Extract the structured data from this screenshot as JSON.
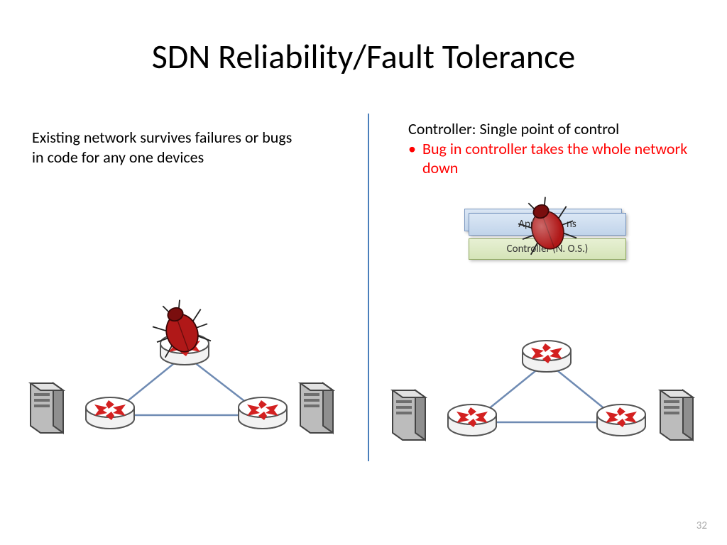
{
  "title": "SDN Reliability/Fault Tolerance",
  "left_text": "Existing network survives failures or bugs in code for any one devices",
  "right_heading": "Controller: Single point of control",
  "right_bullet": "Bug in controller takes the whole network down",
  "app_label": "Applications",
  "app_label_partial_left": "App",
  "app_label_partial_right": "ns",
  "controller_label": "Controller (N. O.S.)",
  "page_number": "32",
  "icons": {
    "bug": "bug-icon",
    "router": "router-icon",
    "server": "server-icon"
  }
}
